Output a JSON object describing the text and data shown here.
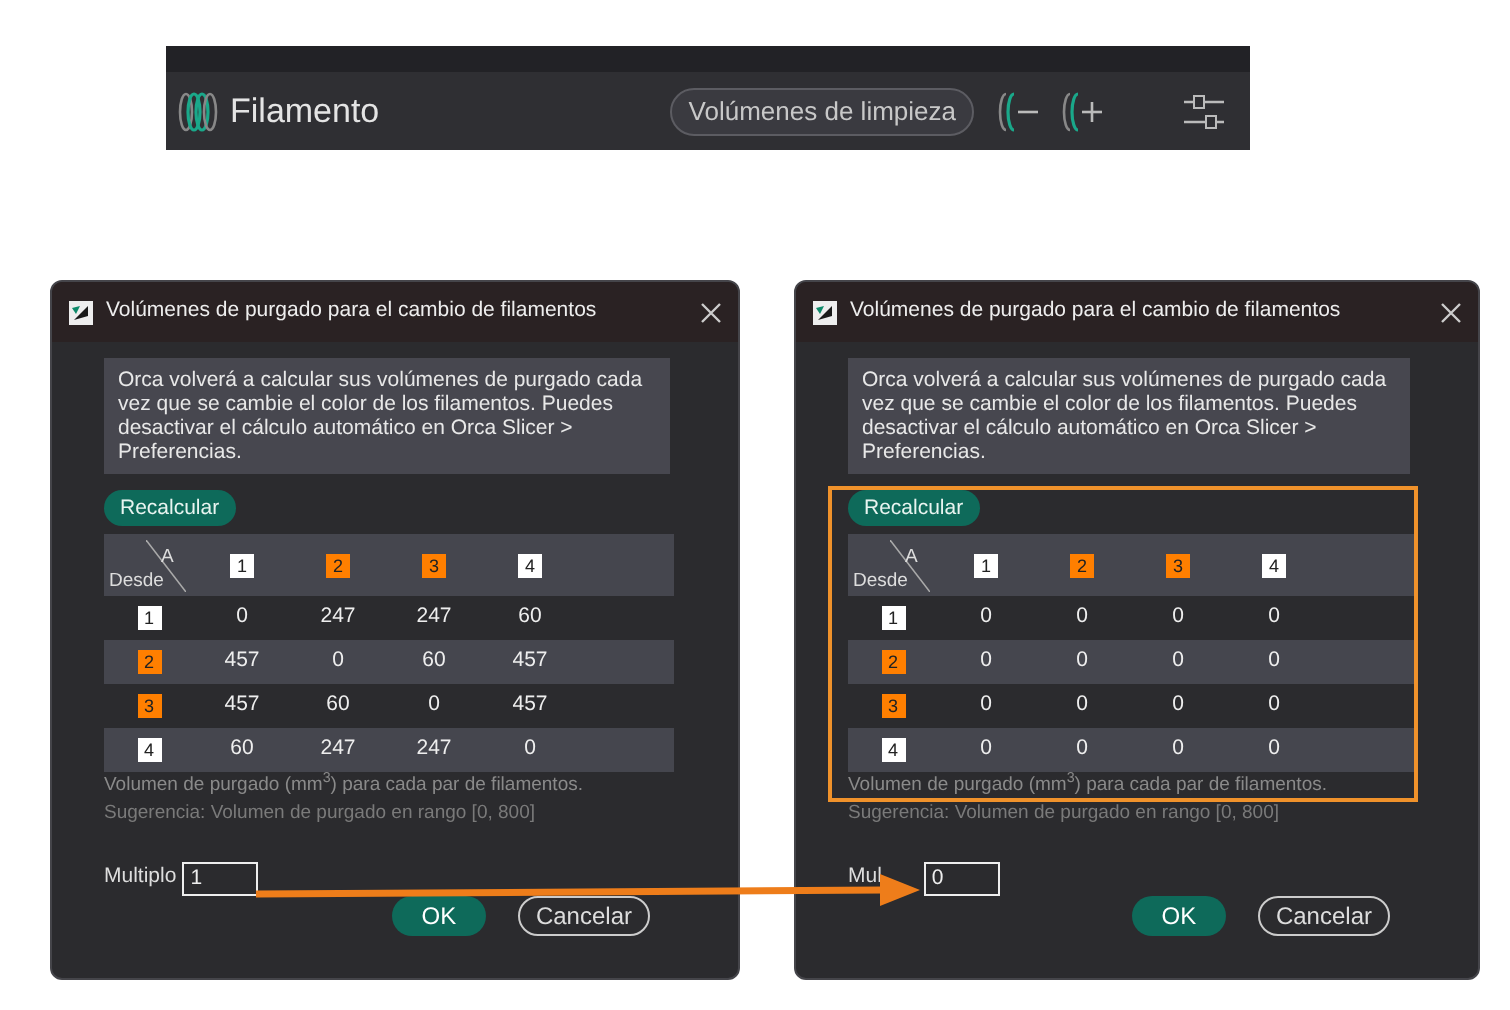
{
  "toolbar": {
    "title": "Filamento",
    "button": "Volúmenes de limpieza"
  },
  "dialogs": [
    {
      "title": "Volúmenes de purgado para el cambio de filamentos",
      "message": "Orca volverá a calcular sus volúmenes de purgado cada vez que se cambie el color de los filamentos. Puedes desactivar el cálculo automático en Orca Slicer > Preferencias.",
      "recalc_button": "Recalcular",
      "corner_to": "A",
      "corner_from": "Desde",
      "highlighted": false,
      "columns": [
        {
          "label": "1",
          "color": "#ffffff"
        },
        {
          "label": "2",
          "color": "#ff7f00"
        },
        {
          "label": "3",
          "color": "#ff7f00"
        },
        {
          "label": "4",
          "color": "#ffffff"
        }
      ],
      "rows": [
        {
          "label": "1",
          "color": "#ffffff",
          "values": [
            "0",
            "247",
            "247",
            "60"
          ]
        },
        {
          "label": "2",
          "color": "#ff7f00",
          "values": [
            "457",
            "0",
            "60",
            "457"
          ]
        },
        {
          "label": "3",
          "color": "#ff7f00",
          "values": [
            "457",
            "60",
            "0",
            "457"
          ]
        },
        {
          "label": "4",
          "color": "#ffffff",
          "values": [
            "60",
            "247",
            "247",
            "0"
          ]
        }
      ],
      "note": "Volumen de purgado (mm$^{3}$) para cada par de filamentos.",
      "hint": "Sugerencia: Volumen de purgado en rango [0, 800]",
      "multiplier_label": "Multiplo",
      "multiplier_value": "1",
      "ok_button": "OK",
      "cancel_button": "Cancelar"
    },
    {
      "title": "Volúmenes de purgado para el cambio de filamentos",
      "message": "Orca volverá a calcular sus volúmenes de purgado cada vez que se cambie el color de los filamentos. Puedes desactivar el cálculo automático en Orca Slicer > Preferencias.",
      "recalc_button": "Recalcular",
      "corner_to": "A",
      "corner_from": "Desde",
      "highlighted": true,
      "columns": [
        {
          "label": "1",
          "color": "#ffffff"
        },
        {
          "label": "2",
          "color": "#ff7f00"
        },
        {
          "label": "3",
          "color": "#ff7f00"
        },
        {
          "label": "4",
          "color": "#ffffff"
        }
      ],
      "rows": [
        {
          "label": "1",
          "color": "#ffffff",
          "values": [
            "0",
            "0",
            "0",
            "0"
          ]
        },
        {
          "label": "2",
          "color": "#ff7f00",
          "values": [
            "0",
            "0",
            "0",
            "0"
          ]
        },
        {
          "label": "3",
          "color": "#ff7f00",
          "values": [
            "0",
            "0",
            "0",
            "0"
          ]
        },
        {
          "label": "4",
          "color": "#ffffff",
          "values": [
            "0",
            "0",
            "0",
            "0"
          ]
        }
      ],
      "note": "Volumen de purgado (mm$^{3}$) para cada par de filamentos.",
      "hint": "Sugerencia: Volumen de purgado en rango [0, 800]",
      "multiplier_label": "Mul",
      "multiplier_value": "0",
      "ok_button": "OK",
      "cancel_button": "Cancelar"
    }
  ]
}
